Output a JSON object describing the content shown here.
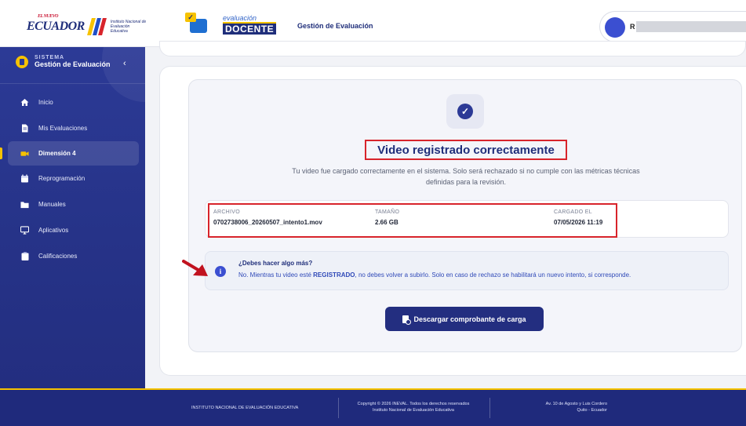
{
  "header": {
    "country_logo_text": "ECUADOR",
    "country_logo_small": "EL NUEVO",
    "institute_logo_text": [
      "Instituto Nacional de",
      "Evaluación Educativa"
    ],
    "eval_logo_small": "evaluación",
    "eval_logo_big": "DOCENTE",
    "title": "Gestión de Evaluación",
    "user_initial": "R"
  },
  "sidebar": {
    "system_label": "SISTEMA",
    "system_title": "Gestión de Evaluación",
    "collapse_glyph": "‹",
    "items": [
      {
        "label": "Inicio",
        "icon": "home-icon",
        "active": false
      },
      {
        "label": "Mis Evaluaciones",
        "icon": "document-icon",
        "active": false
      },
      {
        "label": "Dimensión 4",
        "icon": "video-icon",
        "active": true
      },
      {
        "label": "Reprogramación",
        "icon": "calendar-icon",
        "active": false
      },
      {
        "label": "Manuales",
        "icon": "folder-icon",
        "active": false
      },
      {
        "label": "Aplicativos",
        "icon": "monitor-icon",
        "active": false
      },
      {
        "label": "Calificaciones",
        "icon": "clipboard-icon",
        "active": false
      }
    ]
  },
  "main": {
    "success_title": "Video registrado correctamente",
    "success_desc": "Tu video fue cargado correctamente en el sistema. Solo será rechazado si no cumple con las métricas técnicas definidas para la revisión.",
    "file": {
      "col_file": "ARCHIVO",
      "col_size": "TAMAÑO",
      "col_loaded": "CARGADO EL",
      "file_name": "0702738006_20260507_intento1.mov",
      "size": "2.66 GB",
      "loaded_at": "07/05/2026 11:19"
    },
    "info": {
      "title": "¿Debes hacer algo más?",
      "text_before": "No. Mientras tu video esté ",
      "text_bold": "REGISTRADO",
      "text_after": ", no debes volver a subirlo. Solo en caso de rechazo se habilitará un nuevo intento, si corresponde."
    },
    "download_label": "Descargar comprobante de carga"
  },
  "footer": {
    "institute": "INSTITUTO NACIONAL DE EVALUACIÓN EDUCATIVA",
    "copyright_1": "Copyright © 2026 INEVAL. Todos los derechos reservados",
    "copyright_2": "Instituto Nacional de Evaluación Educativa",
    "address_1": "Av. 10 de Agosto y Luis Cordero",
    "address_2": "Quito - Ecuador"
  },
  "colors": {
    "primary": "#232e80",
    "accent": "#f6c200",
    "highlight": "#d8242b",
    "info_text": "#2f49b8"
  }
}
